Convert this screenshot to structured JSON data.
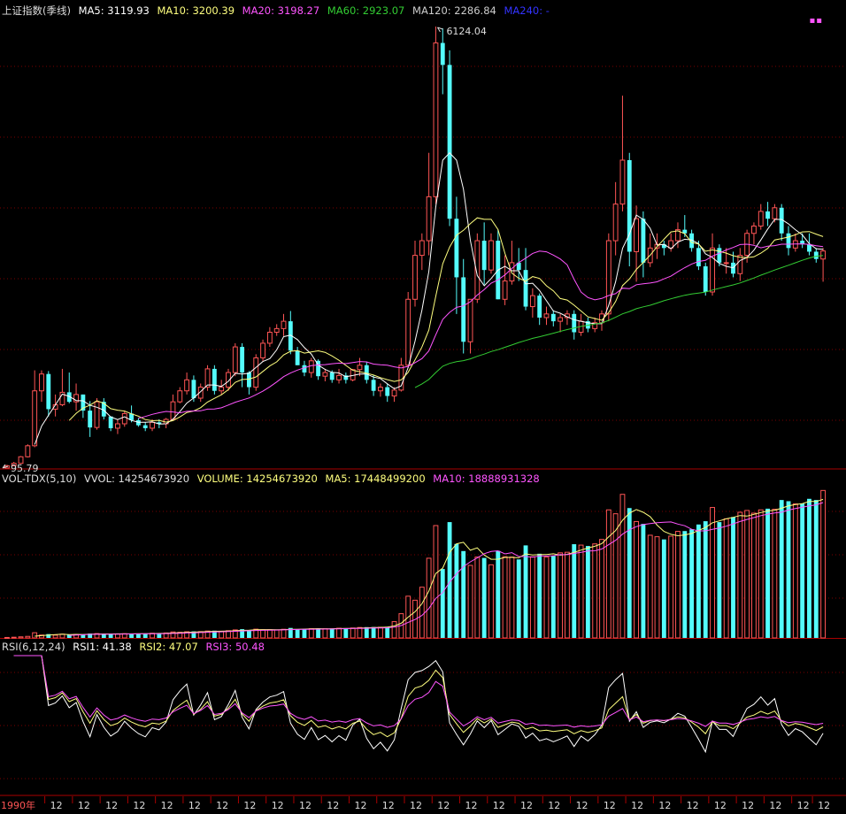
{
  "header": {
    "symbol": "上证指数(季线)",
    "ma5": "MA5: 3119.93",
    "ma10": "MA10: 3200.39",
    "ma20": "MA20: 3198.27",
    "ma60": "MA60: 2923.07",
    "ma120": "MA120: 2286.84",
    "ma240": "MA240: -",
    "peak_label": "6124.04",
    "low_label": "95.79",
    "corner_marker": "▪▪"
  },
  "volume_panel": {
    "name": "VOL-TDX(5,10)",
    "vvol": "VVOL: 14254673920",
    "volume": "VOLUME: 14254673920",
    "ma5": "MA5: 17448499200",
    "ma10": "MA10: 18888931328"
  },
  "rsi_panel": {
    "name": "RSI(6,12,24)",
    "rsi1": "RSI1: 41.38",
    "rsi2": "RSI2: 47.07",
    "rsi3": "RSI3: 50.48"
  },
  "x_axis": {
    "first_label": "1990年",
    "repeat_label": "12"
  },
  "colors": {
    "up": "#ff5555",
    "down": "#54fcfc",
    "ma5": "#ffffff",
    "ma10": "#ffff7f",
    "ma20": "#ff55ff",
    "ma60": "#33cc33",
    "ma120": "#cccccc",
    "ma240": "#3333ff",
    "grid": "#7a0000",
    "frame": "#aa0000",
    "text": "#dddddd"
  },
  "chart_data": {
    "type": "candlestick",
    "period": "quarterly",
    "price": {
      "ylim": [
        95.79,
        6124.04
      ],
      "high": 6124.04,
      "low": 95.79,
      "candles": [
        {
          "o": 96,
          "h": 140,
          "l": 96,
          "c": 128
        },
        {
          "o": 128,
          "h": 180,
          "l": 120,
          "c": 160
        },
        {
          "o": 160,
          "h": 260,
          "l": 150,
          "c": 250
        },
        {
          "o": 250,
          "h": 420,
          "l": 240,
          "c": 400
        },
        {
          "o": 400,
          "h": 1430,
          "l": 380,
          "c": 1150
        },
        {
          "o": 1150,
          "h": 1430,
          "l": 1000,
          "c": 1380
        },
        {
          "o": 1380,
          "h": 1420,
          "l": 800,
          "c": 900
        },
        {
          "o": 900,
          "h": 1100,
          "l": 800,
          "c": 960
        },
        {
          "o": 960,
          "h": 1450,
          "l": 940,
          "c": 1130
        },
        {
          "o": 1130,
          "h": 1400,
          "l": 980,
          "c": 1000
        },
        {
          "o": 1000,
          "h": 1250,
          "l": 880,
          "c": 1100
        },
        {
          "o": 1100,
          "h": 1100,
          "l": 780,
          "c": 880
        },
        {
          "o": 880,
          "h": 1010,
          "l": 520,
          "c": 650
        },
        {
          "o": 650,
          "h": 1050,
          "l": 620,
          "c": 1000
        },
        {
          "o": 1000,
          "h": 1050,
          "l": 760,
          "c": 800
        },
        {
          "o": 800,
          "h": 800,
          "l": 600,
          "c": 640
        },
        {
          "o": 640,
          "h": 760,
          "l": 560,
          "c": 700
        },
        {
          "o": 700,
          "h": 880,
          "l": 660,
          "c": 840
        },
        {
          "o": 840,
          "h": 950,
          "l": 720,
          "c": 750
        },
        {
          "o": 750,
          "h": 780,
          "l": 660,
          "c": 680
        },
        {
          "o": 680,
          "h": 720,
          "l": 600,
          "c": 640
        },
        {
          "o": 640,
          "h": 760,
          "l": 600,
          "c": 720
        },
        {
          "o": 720,
          "h": 760,
          "l": 640,
          "c": 700
        },
        {
          "o": 700,
          "h": 780,
          "l": 640,
          "c": 760
        },
        {
          "o": 760,
          "h": 1100,
          "l": 750,
          "c": 1000
        },
        {
          "o": 1000,
          "h": 1200,
          "l": 980,
          "c": 1150
        },
        {
          "o": 1150,
          "h": 1400,
          "l": 1100,
          "c": 1300
        },
        {
          "o": 1300,
          "h": 1360,
          "l": 1000,
          "c": 1050
        },
        {
          "o": 1050,
          "h": 1250,
          "l": 1000,
          "c": 1200
        },
        {
          "o": 1200,
          "h": 1500,
          "l": 1150,
          "c": 1450
        },
        {
          "o": 1450,
          "h": 1500,
          "l": 1100,
          "c": 1150
        },
        {
          "o": 1150,
          "h": 1300,
          "l": 1100,
          "c": 1200
        },
        {
          "o": 1200,
          "h": 1450,
          "l": 1150,
          "c": 1400
        },
        {
          "o": 1400,
          "h": 1800,
          "l": 1350,
          "c": 1750
        },
        {
          "o": 1750,
          "h": 1800,
          "l": 1200,
          "c": 1400
        },
        {
          "o": 1400,
          "h": 1420,
          "l": 1100,
          "c": 1200
        },
        {
          "o": 1200,
          "h": 1650,
          "l": 1150,
          "c": 1600
        },
        {
          "o": 1600,
          "h": 1850,
          "l": 1550,
          "c": 1800
        },
        {
          "o": 1800,
          "h": 2020,
          "l": 1750,
          "c": 1950
        },
        {
          "o": 1950,
          "h": 2060,
          "l": 1900,
          "c": 2000
        },
        {
          "o": 2000,
          "h": 2200,
          "l": 1900,
          "c": 2100
        },
        {
          "o": 2100,
          "h": 2240,
          "l": 1650,
          "c": 1700
        },
        {
          "o": 1700,
          "h": 1750,
          "l": 1500,
          "c": 1500
        },
        {
          "o": 1500,
          "h": 1560,
          "l": 1350,
          "c": 1400
        },
        {
          "o": 1400,
          "h": 1600,
          "l": 1330,
          "c": 1560
        },
        {
          "o": 1560,
          "h": 1580,
          "l": 1300,
          "c": 1350
        },
        {
          "o": 1350,
          "h": 1450,
          "l": 1280,
          "c": 1400
        },
        {
          "o": 1400,
          "h": 1430,
          "l": 1260,
          "c": 1300
        },
        {
          "o": 1300,
          "h": 1450,
          "l": 1250,
          "c": 1360
        },
        {
          "o": 1360,
          "h": 1400,
          "l": 1250,
          "c": 1300
        },
        {
          "o": 1300,
          "h": 1450,
          "l": 1280,
          "c": 1440
        },
        {
          "o": 1440,
          "h": 1600,
          "l": 1350,
          "c": 1500
        },
        {
          "o": 1500,
          "h": 1550,
          "l": 1250,
          "c": 1300
        },
        {
          "o": 1300,
          "h": 1360,
          "l": 1080,
          "c": 1150
        },
        {
          "o": 1150,
          "h": 1250,
          "l": 1070,
          "c": 1200
        },
        {
          "o": 1200,
          "h": 1250,
          "l": 1000,
          "c": 1080
        },
        {
          "o": 1080,
          "h": 1200,
          "l": 1000,
          "c": 1160
        },
        {
          "o": 1160,
          "h": 1600,
          "l": 1140,
          "c": 1500
        },
        {
          "o": 1500,
          "h": 2500,
          "l": 1460,
          "c": 2400
        },
        {
          "o": 2400,
          "h": 3200,
          "l": 2300,
          "c": 3000
        },
        {
          "o": 3000,
          "h": 3300,
          "l": 2800,
          "c": 3200
        },
        {
          "o": 3200,
          "h": 4400,
          "l": 3000,
          "c": 3800
        },
        {
          "o": 3800,
          "h": 6124,
          "l": 3700,
          "c": 5900
        },
        {
          "o": 5900,
          "h": 6100,
          "l": 5200,
          "c": 5600
        },
        {
          "o": 5600,
          "h": 5800,
          "l": 3400,
          "c": 3500
        },
        {
          "o": 3500,
          "h": 3800,
          "l": 2200,
          "c": 2700
        },
        {
          "o": 2700,
          "h": 2950,
          "l": 1660,
          "c": 1820
        },
        {
          "o": 1820,
          "h": 2400,
          "l": 1660,
          "c": 2400
        },
        {
          "o": 2400,
          "h": 3300,
          "l": 2350,
          "c": 3200
        },
        {
          "o": 3200,
          "h": 3450,
          "l": 2600,
          "c": 2800
        },
        {
          "o": 2800,
          "h": 3300,
          "l": 2750,
          "c": 3200
        },
        {
          "o": 3200,
          "h": 3350,
          "l": 2400,
          "c": 2400
        },
        {
          "o": 2400,
          "h": 3000,
          "l": 2320,
          "c": 2650
        },
        {
          "o": 2650,
          "h": 3200,
          "l": 2600,
          "c": 2900
        },
        {
          "o": 2900,
          "h": 3100,
          "l": 2650,
          "c": 2800
        },
        {
          "o": 2800,
          "h": 3100,
          "l": 2250,
          "c": 2300
        },
        {
          "o": 2300,
          "h": 2550,
          "l": 2150,
          "c": 2450
        },
        {
          "o": 2450,
          "h": 2480,
          "l": 2050,
          "c": 2150
        },
        {
          "o": 2150,
          "h": 2300,
          "l": 2050,
          "c": 2200
        },
        {
          "o": 2200,
          "h": 2250,
          "l": 2030,
          "c": 2100
        },
        {
          "o": 2100,
          "h": 2200,
          "l": 1950,
          "c": 2150
        },
        {
          "o": 2150,
          "h": 2250,
          "l": 2050,
          "c": 2200
        },
        {
          "o": 2200,
          "h": 2250,
          "l": 1850,
          "c": 1950
        },
        {
          "o": 1950,
          "h": 2200,
          "l": 1900,
          "c": 2100
        },
        {
          "o": 2100,
          "h": 2150,
          "l": 1950,
          "c": 2000
        },
        {
          "o": 2000,
          "h": 2150,
          "l": 1950,
          "c": 2080
        },
        {
          "o": 2080,
          "h": 2250,
          "l": 1970,
          "c": 2200
        },
        {
          "o": 2200,
          "h": 3300,
          "l": 2100,
          "c": 3200
        },
        {
          "o": 3200,
          "h": 4000,
          "l": 3000,
          "c": 3700
        },
        {
          "o": 3700,
          "h": 5180,
          "l": 3600,
          "c": 4300
        },
        {
          "o": 4300,
          "h": 4400,
          "l": 2850,
          "c": 3050
        },
        {
          "o": 3050,
          "h": 3680,
          "l": 2640,
          "c": 3500
        },
        {
          "o": 3500,
          "h": 3600,
          "l": 2700,
          "c": 2900
        },
        {
          "o": 2900,
          "h": 3300,
          "l": 2840,
          "c": 3100
        },
        {
          "o": 3100,
          "h": 3300,
          "l": 2950,
          "c": 3150
        },
        {
          "o": 3150,
          "h": 3200,
          "l": 3000,
          "c": 3100
        },
        {
          "o": 3100,
          "h": 3300,
          "l": 3050,
          "c": 3200
        },
        {
          "o": 3200,
          "h": 3450,
          "l": 3100,
          "c": 3350
        },
        {
          "o": 3350,
          "h": 3550,
          "l": 3250,
          "c": 3300
        },
        {
          "o": 3300,
          "h": 3350,
          "l": 3050,
          "c": 3100
        },
        {
          "o": 3100,
          "h": 3200,
          "l": 2800,
          "c": 2850
        },
        {
          "o": 2850,
          "h": 2900,
          "l": 2450,
          "c": 2500
        },
        {
          "o": 2500,
          "h": 3300,
          "l": 2450,
          "c": 3100
        },
        {
          "o": 3100,
          "h": 3150,
          "l": 2850,
          "c": 2900
        },
        {
          "o": 2900,
          "h": 3100,
          "l": 2750,
          "c": 2900
        },
        {
          "o": 2900,
          "h": 3050,
          "l": 2700,
          "c": 2750
        },
        {
          "o": 2750,
          "h": 3100,
          "l": 2650,
          "c": 3000
        },
        {
          "o": 3000,
          "h": 3350,
          "l": 2900,
          "c": 3300
        },
        {
          "o": 3300,
          "h": 3450,
          "l": 3150,
          "c": 3400
        },
        {
          "o": 3400,
          "h": 3700,
          "l": 3350,
          "c": 3600
        },
        {
          "o": 3600,
          "h": 3730,
          "l": 3400,
          "c": 3500
        },
        {
          "o": 3500,
          "h": 3700,
          "l": 3450,
          "c": 3650
        },
        {
          "o": 3650,
          "h": 3700,
          "l": 3200,
          "c": 3300
        },
        {
          "o": 3300,
          "h": 3400,
          "l": 3000,
          "c": 3100
        },
        {
          "o": 3100,
          "h": 3300,
          "l": 3050,
          "c": 3200
        },
        {
          "o": 3200,
          "h": 3300,
          "l": 3100,
          "c": 3150
        },
        {
          "o": 3150,
          "h": 3300,
          "l": 3000,
          "c": 3050
        },
        {
          "o": 3050,
          "h": 3100,
          "l": 2900,
          "c": 2950
        },
        {
          "o": 2950,
          "h": 3100,
          "l": 2640,
          "c": 3060
        }
      ]
    },
    "volume": {
      "last": 14254673920,
      "ma5_last": 17448499200,
      "ma10_last": 18888931328,
      "ylim_billion": [
        0,
        52
      ]
    },
    "rsi": {
      "params": [
        6,
        12,
        24
      ],
      "rsi1_last": 41.38,
      "rsi2_last": 47.07,
      "rsi3_last": 50.48,
      "ylim": [
        0,
        100
      ]
    }
  }
}
